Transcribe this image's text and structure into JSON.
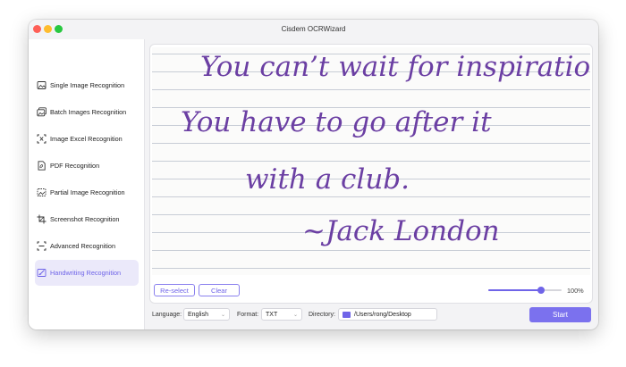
{
  "window": {
    "title": "Cisdem OCRWizard"
  },
  "sidebar": {
    "items": [
      {
        "label": "Single Image Recognition",
        "icon": "image-icon",
        "active": false
      },
      {
        "label": "Batch Images Recognition",
        "icon": "images-stack-icon",
        "active": false
      },
      {
        "label": "Image Excel Recognition",
        "icon": "excel-scan-icon",
        "active": false
      },
      {
        "label": "PDF Recognition",
        "icon": "pdf-icon",
        "active": false
      },
      {
        "label": "Partial Image Recognition",
        "icon": "partial-image-icon",
        "active": false
      },
      {
        "label": "Screenshot Recognition",
        "icon": "screenshot-icon",
        "active": false
      },
      {
        "label": "Advanced Recognition",
        "icon": "advanced-scan-icon",
        "active": false
      },
      {
        "label": "Handwriting Recognition",
        "icon": "handwriting-icon",
        "active": true
      }
    ]
  },
  "preview": {
    "lines": [
      "You can’t wait for inspiration.",
      "You have to go after it",
      "with a club.",
      "~Jack London"
    ]
  },
  "controls": {
    "reselect_label": "Re-select",
    "clear_label": "Clear",
    "zoom_text": "100%",
    "zoom_level": 0.72
  },
  "footer": {
    "language_label": "Language:",
    "language_value": "English",
    "format_label": "Format:",
    "format_value": "TXT",
    "directory_label": "Directory:",
    "directory_value": "/Users/rong/Desktop",
    "start_label": "Start"
  },
  "colors": {
    "accent": "#7b71ee",
    "ink": "#6b3fa3",
    "active_bg": "#ebe9fa"
  }
}
